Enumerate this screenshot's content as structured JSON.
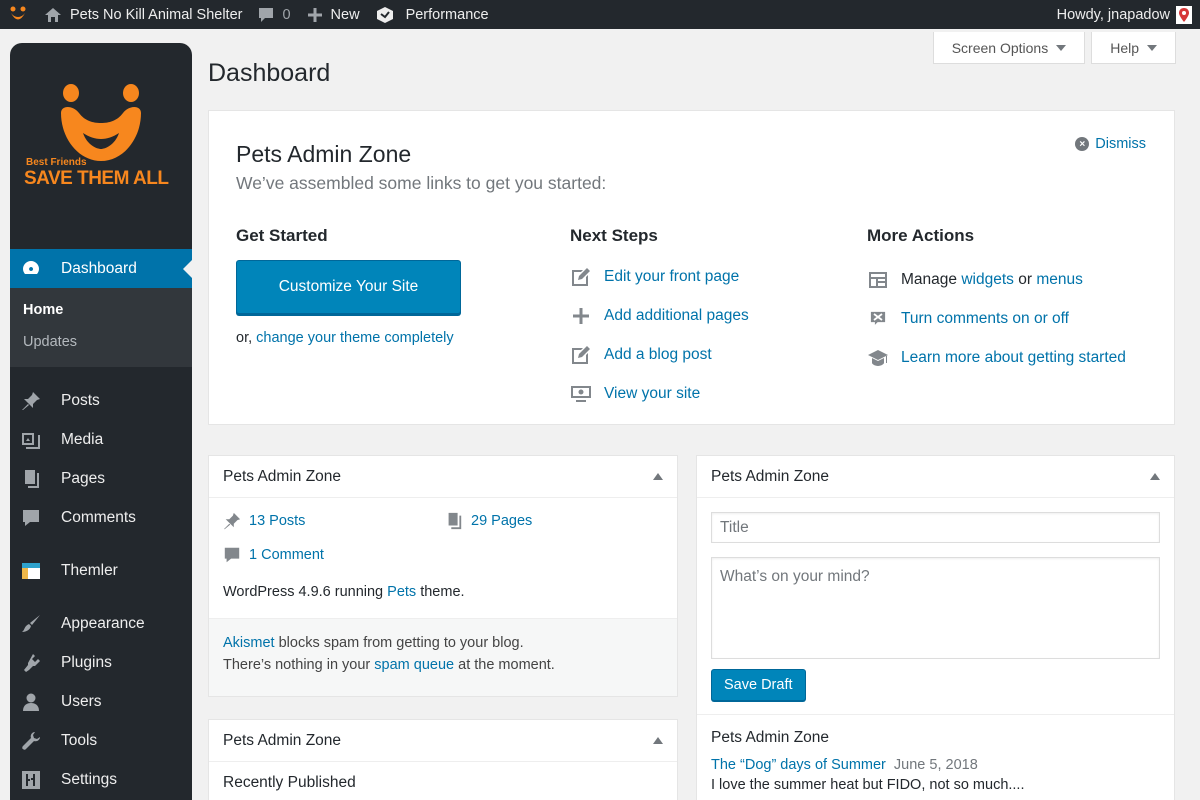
{
  "adminbar": {
    "site_name": "Pets No Kill Animal Shelter",
    "comments_count": "0",
    "new_label": "New",
    "performance_label": "Performance",
    "howdy": "Howdy, jnapadow"
  },
  "logo": {
    "small": "Best Friends",
    "big": "SAVE THEM ALL",
    "color": "#f7871e"
  },
  "sidebar": {
    "dashboard": "Dashboard",
    "submenu": [
      "Home",
      "Updates"
    ],
    "items": [
      "Posts",
      "Media",
      "Pages",
      "Comments",
      "Themler",
      "Appearance",
      "Plugins",
      "Users",
      "Tools",
      "Settings"
    ]
  },
  "header": {
    "screen_options": "Screen Options",
    "help": "Help",
    "title": "Dashboard"
  },
  "welcome": {
    "title": "Pets Admin Zone",
    "subtitle": "We’ve assembled some links to get you started:",
    "dismiss": "Dismiss",
    "get_started": {
      "heading": "Get Started",
      "button": "Customize Your Site",
      "alt_prefix": "or,",
      "alt_link": "change your theme completely"
    },
    "next_steps": {
      "heading": "Next Steps",
      "items": [
        "Edit your front page",
        "Add additional pages",
        "Add a blog post",
        "View your site"
      ]
    },
    "more_actions": {
      "heading": "More Actions",
      "manage_prefix": "Manage",
      "widgets": "widgets",
      "or": "or",
      "menus": "menus",
      "comments_toggle": "Turn comments on or off",
      "learn_more": "Learn more about getting started"
    }
  },
  "glance": {
    "title": "Pets Admin Zone",
    "posts": "13 Posts",
    "pages": "29 Pages",
    "comments": "1 Comment",
    "wp_prefix": "WordPress 4.9.6 running",
    "theme": "Pets",
    "wp_suffix": "theme.",
    "akismet_link": "Akismet",
    "akismet_text": "blocks spam from getting to your blog.",
    "spam_prefix": "There’s nothing in your",
    "spam_link": "spam queue",
    "spam_suffix": "at the moment."
  },
  "quick_draft": {
    "title": "Pets Admin Zone",
    "title_placeholder": "Title",
    "content_placeholder": "What’s on your mind?",
    "save_label": "Save Draft",
    "drafts_heading": "Pets Admin Zone",
    "draft_title": "The “Dog” days of Summer",
    "draft_date": "June 5, 2018",
    "draft_excerpt": "I love the summer heat but FIDO, not so much...."
  },
  "activity": {
    "title": "Pets Admin Zone",
    "recently_published": "Recently Published"
  },
  "colors": {
    "primary": "#0085ba",
    "link": "#0073aa",
    "sidebar": "#23282d",
    "current_menu": "#0073aa"
  }
}
